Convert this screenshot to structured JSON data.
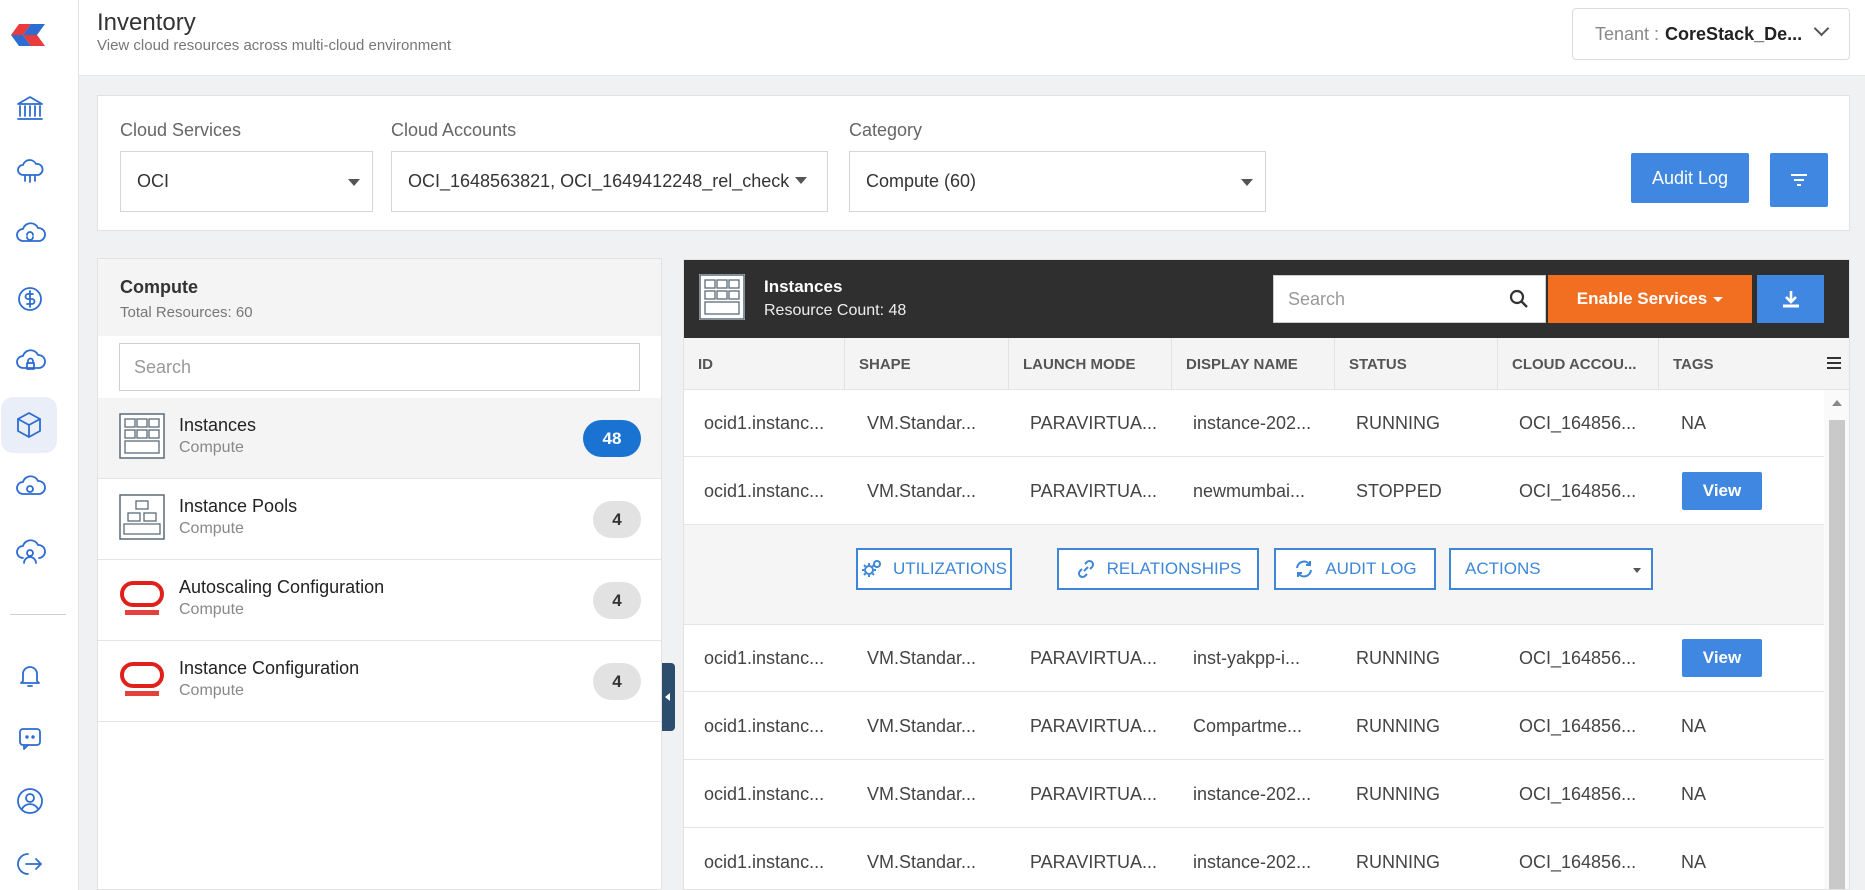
{
  "header": {
    "title": "Inventory",
    "subtitle": "View cloud resources across multi-cloud environment",
    "tenant_label": "Tenant :",
    "tenant_value": "CoreStack_De..."
  },
  "rail": {
    "items": [
      "bank-icon",
      "cloud-network-icon",
      "cloud-refresh-icon",
      "cost-icon",
      "cloud-lock-icon",
      "cube-icon",
      "cloud-gear-icon",
      "cloud-user-icon",
      "bell-icon",
      "chat-icon",
      "profile-icon",
      "logout-icon"
    ],
    "active": "cube-icon"
  },
  "filters": {
    "cloud_services_label": "Cloud Services",
    "cloud_services_value": "OCI",
    "cloud_accounts_label": "Cloud Accounts",
    "cloud_accounts_value": "OCI_1648563821, OCI_1649412248_rel_check",
    "category_label": "Category",
    "category_value": "Compute (60)",
    "audit_log_label": "Audit Log"
  },
  "left_panel": {
    "title": "Compute",
    "subtitle": "Total Resources: 60",
    "search_placeholder": "Search",
    "items": [
      {
        "name": "Instances",
        "category": "Compute",
        "count": "48"
      },
      {
        "name": "Instance Pools",
        "category": "Compute",
        "count": "4"
      },
      {
        "name": "Autoscaling Configuration",
        "category": "Compute",
        "count": "4"
      },
      {
        "name": "Instance Configuration",
        "category": "Compute",
        "count": "4"
      }
    ]
  },
  "right_panel": {
    "title": "Instances",
    "subtitle": "Resource Count: 48",
    "search_placeholder": "Search",
    "enable_services_label": "Enable Services",
    "columns": [
      "ID",
      "SHAPE",
      "LAUNCH MODE",
      "DISPLAY NAME",
      "STATUS",
      "CLOUD ACCOU...",
      "TAGS"
    ],
    "rows": [
      {
        "id": "ocid1.instanc...",
        "shape": "VM.Standar...",
        "launch_mode": "PARAVIRTUA...",
        "display_name": "instance-202...",
        "status": "RUNNING",
        "cloud_account": "OCI_164856...",
        "tags": "NA"
      },
      {
        "id": "ocid1.instanc...",
        "shape": "VM.Standar...",
        "launch_mode": "PARAVIRTUA...",
        "display_name": "newmumbai...",
        "status": "STOPPED",
        "cloud_account": "OCI_164856...",
        "tags": "View"
      },
      {
        "id": "ocid1.instanc...",
        "shape": "VM.Standar...",
        "launch_mode": "PARAVIRTUA...",
        "display_name": "inst-yakpp-i...",
        "status": "RUNNING",
        "cloud_account": "OCI_164856...",
        "tags": "View"
      },
      {
        "id": "ocid1.instanc...",
        "shape": "VM.Standar...",
        "launch_mode": "PARAVIRTUA...",
        "display_name": "Compartme...",
        "status": "RUNNING",
        "cloud_account": "OCI_164856...",
        "tags": "NA"
      },
      {
        "id": "ocid1.instanc...",
        "shape": "VM.Standar...",
        "launch_mode": "PARAVIRTUA...",
        "display_name": "instance-202...",
        "status": "RUNNING",
        "cloud_account": "OCI_164856...",
        "tags": "NA"
      },
      {
        "id": "ocid1.instanc...",
        "shape": "VM.Standar...",
        "launch_mode": "PARAVIRTUA...",
        "display_name": "instance-202...",
        "status": "RUNNING",
        "cloud_account": "OCI_164856...",
        "tags": "NA"
      }
    ],
    "row_actions": {
      "utilizations": "UTILIZATIONS",
      "relationships": "RELATIONSHIPS",
      "audit_log": "AUDIT LOG",
      "actions": "ACTIONS"
    }
  },
  "colors": {
    "accent_blue": "#3f87e0",
    "badge_blue": "#1b73d1",
    "orange": "#f26f21",
    "dark_header": "#2f2f2f",
    "oracle_red": "#e0201a"
  }
}
